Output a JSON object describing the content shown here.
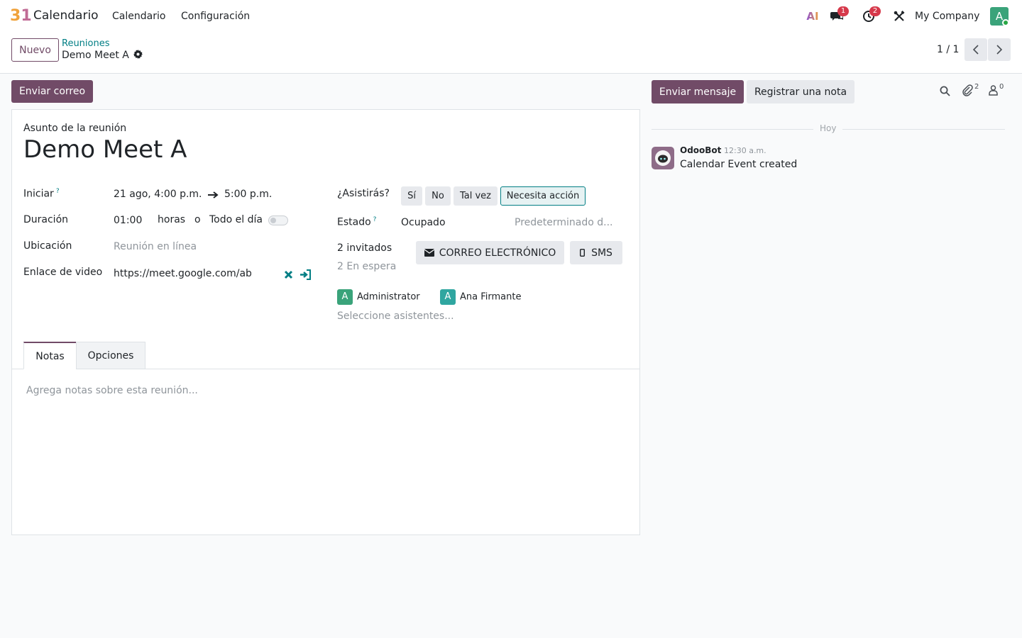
{
  "navbar": {
    "app_name": "Calendario",
    "menu": [
      "Calendario",
      "Configuración"
    ],
    "ai_label": "AI",
    "messages_badge": "1",
    "activities_badge": "2",
    "company": "My Company",
    "user_initial": "A"
  },
  "control": {
    "new_button": "Nuevo",
    "breadcrumb_parent": "Reuniones",
    "breadcrumb_current": "Demo Meet A",
    "pager": "1 / 1"
  },
  "actions": {
    "send_email": "Enviar correo"
  },
  "form": {
    "subject_label": "Asunto de la reunión",
    "subject": "Demo Meet A",
    "start_label": "Iniciar",
    "start_date": "21 ago, 4:00 p.m.",
    "end_time": "5:00 p.m.",
    "duration_label": "Duración",
    "duration": "01:00",
    "hours_word": "horas",
    "or_word": "o",
    "allday_label": "Todo el día",
    "location_label": "Ubicación",
    "location_placeholder": "Reunión en línea",
    "video_label": "Enlace de video",
    "video_link": "https://meet.google.com/ab",
    "attend_label": "¿Asistirás?",
    "attend_options": [
      "Sí",
      "No",
      "Tal vez",
      "Necesita acción"
    ],
    "status_label": "Estado",
    "status": "Ocupado",
    "privacy_placeholder": "Predeterminado d...",
    "invited": "2 invitados",
    "waiting": "2 En espera",
    "email_button": "CORREO ELECTRÓNICO",
    "sms_button": "SMS",
    "attendees": [
      {
        "initial": "A",
        "name": "Administrator",
        "color": "#3aa37a"
      },
      {
        "initial": "A",
        "name": "Ana Firmante",
        "color": "#2fa6a0"
      }
    ],
    "attendee_placeholder": "Seleccione asistentes...",
    "tabs": [
      "Notas",
      "Opciones"
    ],
    "notes_placeholder": "Agrega notas sobre esta reunión..."
  },
  "chatter": {
    "send_message": "Enviar mensaje",
    "log_note": "Registrar una nota",
    "attachments_count": "2",
    "followers_count": "0",
    "date_separator": "Hoy",
    "messages": [
      {
        "author": "OdooBot",
        "time": "12:30 a.m.",
        "body": "Calendar Event created"
      }
    ]
  },
  "colors": {
    "primary": "#714b67",
    "link": "#017e84",
    "badge": "#d6394b"
  }
}
